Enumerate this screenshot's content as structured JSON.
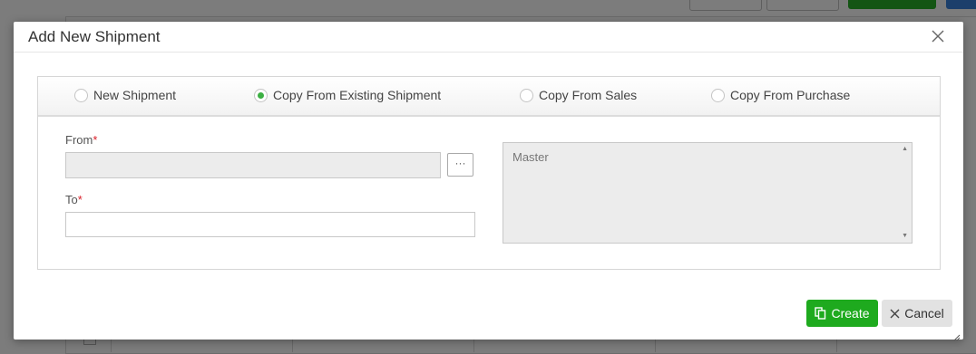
{
  "colors": {
    "accent_green": "#1eaa1e",
    "radio_checked": "#3cb043",
    "required": "#d9202a",
    "overlay": "#7c7c7c"
  },
  "dialog": {
    "title": "Add New Shipment",
    "close_icon": "close-icon"
  },
  "options": [
    {
      "label": "New Shipment",
      "checked": false
    },
    {
      "label": "Copy From Existing Shipment",
      "checked": true
    },
    {
      "label": "Copy From Sales",
      "checked": false
    },
    {
      "label": "Copy From Purchase",
      "checked": false
    }
  ],
  "form": {
    "from_label": "From",
    "from_value": "",
    "to_label": "To",
    "to_value": "",
    "required_marker": "*",
    "browse_label": "···",
    "master_text": "Master"
  },
  "footer": {
    "create_label": "Create",
    "create_icon": "copy-icon",
    "cancel_label": "Cancel",
    "cancel_icon": "x-icon"
  }
}
